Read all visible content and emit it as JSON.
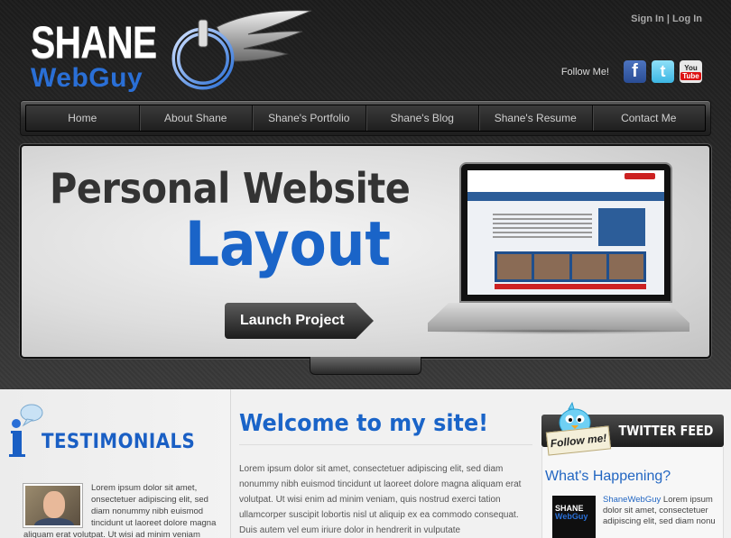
{
  "logo": {
    "line1": "SHANE",
    "line2": "WebGuy"
  },
  "header": {
    "sign_in": "Sign In",
    "separator": "|",
    "log_in": "Log In",
    "follow_label": "Follow Me!",
    "social": [
      {
        "icon": "facebook-icon",
        "glyph": "f"
      },
      {
        "icon": "twitter-icon",
        "glyph": "t"
      },
      {
        "icon": "youtube-icon",
        "glyph_top": "You",
        "glyph_bottom": "Tube"
      }
    ]
  },
  "nav": {
    "items": [
      {
        "label": "Home"
      },
      {
        "label": "About Shane"
      },
      {
        "label": "Shane's Portfolio"
      },
      {
        "label": "Shane's Blog"
      },
      {
        "label": "Shane's Resume"
      },
      {
        "label": "Contact Me"
      }
    ]
  },
  "banner": {
    "title_line1": "Personal Website",
    "title_line2": "Layout",
    "button": "Launch Project"
  },
  "testimonials": {
    "heading": "TESTIMONIALS",
    "text": "Lorem ipsum dolor sit amet, onsectetuer adipiscing elit, sed diam nonummy nibh euismod tincidunt ut laoreet dolore magna",
    "text_continued": "aliquam erat volutpat. Ut wisi ad minim veniam"
  },
  "welcome": {
    "title": "Welcome to my site!",
    "text": "Lorem ipsum dolor sit amet, consectetuer adipiscing elit, sed diam nonummy nibh euismod tincidunt ut laoreet dolore magna aliquam erat volutpat. Ut wisi enim ad minim veniam, quis nostrud exerci tation ullamcorper suscipit lobortis nisl ut aliquip ex ea commodo consequat. Duis autem vel eum iriure dolor in hendrerit in vulputate"
  },
  "twitter": {
    "header": "TWITTER FEED",
    "follow_badge": "Follow me!",
    "subheading": "What's Happening?",
    "avatar_line1": "SHANE",
    "avatar_line2": "WebGuy",
    "tweet_user": "ShaneWebGuy",
    "tweet_text": "Lorem ipsum dolor sit amet, consectetuer adipiscing elit, sed diam nonu"
  },
  "colors": {
    "accent_blue": "#1a64c8",
    "dark_bg": "#2b2b2b",
    "nav_text": "#cfcfcf"
  }
}
